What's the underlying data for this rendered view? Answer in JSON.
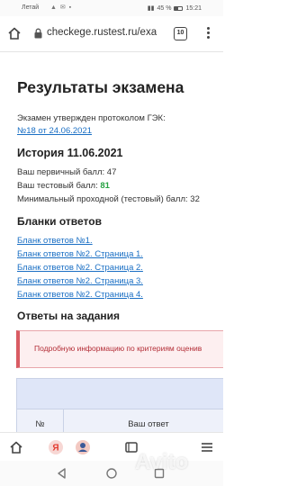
{
  "status_bar": {
    "carrier": "Летай",
    "indicators": "▲ ✉ ▪",
    "battery": "45 %",
    "time": "15:21"
  },
  "browser": {
    "url": "checkege.rustest.ru/exa",
    "tab_count": "10"
  },
  "page": {
    "title": "Результаты экзамена",
    "protocol_label": "Экзамен утвержден протоколом ГЭК:",
    "protocol_link": "№18 от 24.06.2021",
    "history_title": "История 11.06.2021",
    "scores": [
      {
        "label": "Ваш первичный балл:",
        "value": "47"
      },
      {
        "label": "Ваш тестовый балл:",
        "value": "81"
      },
      {
        "label": "Минимальный проходной (тестовый) балл:",
        "value": "32"
      }
    ],
    "forms_title": "Бланки ответов",
    "forms": [
      "Бланк ответов №1.",
      "Бланк ответов №2. Страница 1.",
      "Бланк ответов №2. Страница 2.",
      "Бланк ответов №2. Страница 3.",
      "Бланк ответов №2. Страница 4."
    ],
    "answers_title": "Ответы на задания",
    "notice": "Подробную информацию по критериям оценив",
    "table_headers": {
      "num": "№",
      "answer": "Ваш ответ"
    }
  },
  "toolbar": {
    "items": [
      "home-icon",
      "yandex-icon",
      "avatar",
      "tabs-icon",
      "menu-icon"
    ]
  },
  "watermark": "Avito",
  "colors": {
    "link": "#1a6fc4",
    "score_highlight": "#27a243",
    "notice_border": "#d95b63",
    "table_header": "#dfe6f8"
  }
}
